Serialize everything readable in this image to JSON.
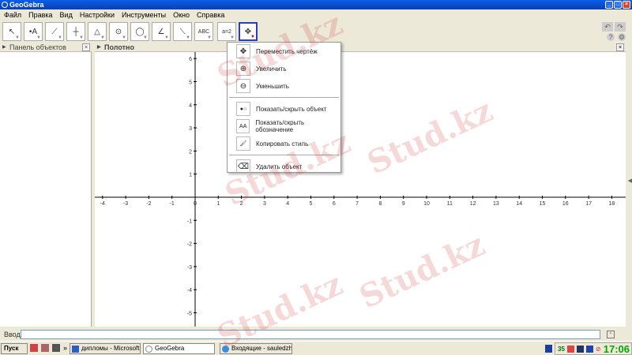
{
  "window": {
    "title": "GeoGebra"
  },
  "menu": [
    "Файл",
    "Правка",
    "Вид",
    "Настройки",
    "Инструменты",
    "Окно",
    "Справка"
  ],
  "tools": [
    {
      "name": "move-tool",
      "glyph": "↖"
    },
    {
      "name": "point-tool",
      "glyph": "•A"
    },
    {
      "name": "line-tool",
      "glyph": "⟋"
    },
    {
      "name": "perpendicular-tool",
      "glyph": "┼"
    },
    {
      "name": "polygon-tool",
      "glyph": "△"
    },
    {
      "name": "circle-tool",
      "glyph": "⊙"
    },
    {
      "name": "conic-tool",
      "glyph": "◯"
    },
    {
      "name": "angle-tool",
      "glyph": "∠"
    },
    {
      "name": "reflect-tool",
      "glyph": "⟍"
    },
    {
      "name": "text-tool",
      "glyph": "ABC"
    },
    {
      "name": "slider-tool",
      "glyph": "a=2"
    },
    {
      "name": "move-graphics-tool",
      "glyph": "✥"
    }
  ],
  "panels": {
    "algebra": "Панель объектов",
    "graphics": "Полотно"
  },
  "dropdown": [
    {
      "label": "Переместить чертёж",
      "icon": "move-graphics-icon",
      "glyph": "✥"
    },
    {
      "label": "Увеличить",
      "icon": "zoom-in-icon",
      "glyph": "⊕"
    },
    {
      "label": "Уменьшить",
      "icon": "zoom-out-icon",
      "glyph": "⊖"
    },
    {
      "label": "Показать/скрыть объект",
      "icon": "show-hide-object-icon",
      "glyph": "●○"
    },
    {
      "label": "Показать/скрыть обозначение",
      "icon": "show-hide-label-icon",
      "glyph": "AA"
    },
    {
      "label": "Копировать стиль",
      "icon": "copy-style-icon",
      "glyph": "🖌"
    },
    {
      "label": "Удалить объект",
      "icon": "delete-icon",
      "glyph": "⌫"
    }
  ],
  "axes": {
    "xlim": [
      -4,
      18
    ],
    "ylim": [
      -5,
      6
    ]
  },
  "input": {
    "label": "Ввод:",
    "value": ""
  },
  "taskbar": {
    "start": "Пуск",
    "tasks": [
      "дипломы - Microsoft Wo...",
      "GeoGebra",
      "Входящие - sauledzh@..."
    ],
    "tray_count": "35",
    "clock": "17:06"
  },
  "watermark": "Stud.kz"
}
